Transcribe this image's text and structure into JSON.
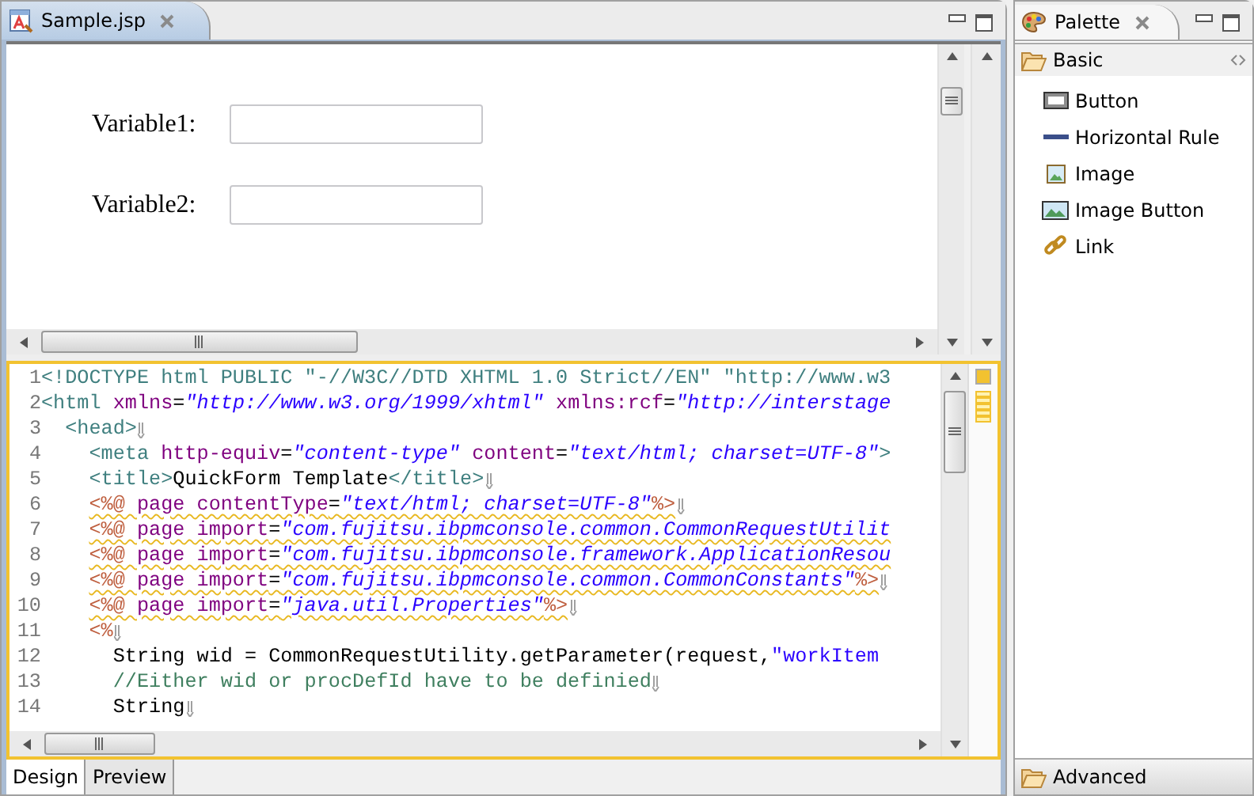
{
  "editor": {
    "tab": {
      "title": "Sample.jsp",
      "selected": true
    },
    "design": {
      "fields": [
        {
          "label": "Variable1:"
        },
        {
          "label": "Variable2:"
        }
      ]
    },
    "source": {
      "lines": [
        {
          "number": "1",
          "warning": false,
          "eol": false,
          "tokens": [
            {
              "kind": "doctype",
              "text": "<!DOCTYPE html PUBLIC \"-//W3C//DTD XHTML 1.0 Strict//EN\" \"http://www.w3"
            }
          ]
        },
        {
          "number": "2",
          "warning": false,
          "eol": false,
          "tokens": [
            {
              "kind": "tag",
              "text": "<html "
            },
            {
              "kind": "attr",
              "text": "xmlns"
            },
            {
              "kind": "plain",
              "text": "="
            },
            {
              "kind": "value",
              "text": "\"http://www.w3.org/1999/xhtml\" "
            },
            {
              "kind": "attr",
              "text": "xmlns:rcf"
            },
            {
              "kind": "plain",
              "text": "="
            },
            {
              "kind": "value",
              "text": "\"http://interstage"
            }
          ]
        },
        {
          "number": "3",
          "warning": false,
          "eol": true,
          "tokens": [
            {
              "kind": "tag",
              "text": "  <head>"
            }
          ]
        },
        {
          "number": "4",
          "warning": false,
          "eol": false,
          "tokens": [
            {
              "kind": "tag",
              "text": "    <meta "
            },
            {
              "kind": "attr",
              "text": "http-equiv"
            },
            {
              "kind": "plain",
              "text": "="
            },
            {
              "kind": "value",
              "text": "\"content-type\" "
            },
            {
              "kind": "attr",
              "text": "content"
            },
            {
              "kind": "plain",
              "text": "="
            },
            {
              "kind": "value",
              "text": "\"text/html; charset=UTF-8\""
            },
            {
              "kind": "tag",
              "text": ">"
            }
          ]
        },
        {
          "number": "5",
          "warning": false,
          "eol": true,
          "tokens": [
            {
              "kind": "tag",
              "text": "    <title>"
            },
            {
              "kind": "plain",
              "text": "QuickForm Template"
            },
            {
              "kind": "tag",
              "text": "</title>"
            }
          ]
        },
        {
          "number": "6",
          "warning": true,
          "eol": true,
          "tokens": [
            {
              "kind": "jsp",
              "text": "    <%@ "
            },
            {
              "kind": "attr",
              "text": "page contentType"
            },
            {
              "kind": "plain",
              "text": "="
            },
            {
              "kind": "value",
              "text": "\"text/html; charset=UTF-8\""
            },
            {
              "kind": "jsp",
              "text": "%>"
            }
          ]
        },
        {
          "number": "7",
          "warning": true,
          "eol": false,
          "tokens": [
            {
              "kind": "jsp",
              "text": "    <%@ "
            },
            {
              "kind": "attr",
              "text": "page import"
            },
            {
              "kind": "plain",
              "text": "="
            },
            {
              "kind": "value",
              "text": "\"com.fujitsu.ibpmconsole.common.CommonRequestUtilit"
            }
          ]
        },
        {
          "number": "8",
          "warning": true,
          "eol": false,
          "tokens": [
            {
              "kind": "jsp",
              "text": "    <%@ "
            },
            {
              "kind": "attr",
              "text": "page import"
            },
            {
              "kind": "plain",
              "text": "="
            },
            {
              "kind": "value",
              "text": "\"com.fujitsu.ibpmconsole.framework.ApplicationResou"
            }
          ]
        },
        {
          "number": "9",
          "warning": true,
          "eol": true,
          "tokens": [
            {
              "kind": "jsp",
              "text": "    <%@ "
            },
            {
              "kind": "attr",
              "text": "page import"
            },
            {
              "kind": "plain",
              "text": "="
            },
            {
              "kind": "value",
              "text": "\"com.fujitsu.ibpmconsole.common.CommonConstants\""
            },
            {
              "kind": "jsp",
              "text": "%>"
            }
          ]
        },
        {
          "number": "10",
          "warning": true,
          "eol": true,
          "tokens": [
            {
              "kind": "jsp",
              "text": "    <%@ "
            },
            {
              "kind": "attr",
              "text": "page import"
            },
            {
              "kind": "plain",
              "text": "="
            },
            {
              "kind": "value",
              "text": "\"java.util.Properties\""
            },
            {
              "kind": "jsp",
              "text": "%>"
            }
          ]
        },
        {
          "number": "11",
          "warning": false,
          "eol": true,
          "tokens": [
            {
              "kind": "jsp",
              "text": "    <%"
            }
          ]
        },
        {
          "number": "12",
          "warning": false,
          "eol": false,
          "tokens": [
            {
              "kind": "plain",
              "text": "      String wid = CommonRequestUtility.getParameter(request,"
            },
            {
              "kind": "string",
              "text": "\"workItem"
            }
          ]
        },
        {
          "number": "13",
          "warning": false,
          "eol": true,
          "tokens": [
            {
              "kind": "comment",
              "text": "      //Either wid or procDefId have to be definied"
            }
          ]
        },
        {
          "number": "14",
          "warning": false,
          "eol": true,
          "tokens": [
            {
              "kind": "plain",
              "text": "      String"
            }
          ]
        }
      ]
    },
    "bottom_tabs": [
      {
        "label": "Design",
        "selected": true
      },
      {
        "label": "Preview",
        "selected": false
      }
    ]
  },
  "palette": {
    "title": "Palette",
    "drawers": [
      {
        "label": "Basic",
        "expanded": true,
        "items": [
          {
            "label": "Button",
            "kind": "button"
          },
          {
            "label": "Horizontal Rule",
            "kind": "rule"
          },
          {
            "label": "Image",
            "kind": "image"
          },
          {
            "label": "Image Button",
            "kind": "image-button"
          },
          {
            "label": "Link",
            "kind": "link"
          }
        ]
      },
      {
        "label": "Advanced",
        "expanded": false
      }
    ]
  }
}
